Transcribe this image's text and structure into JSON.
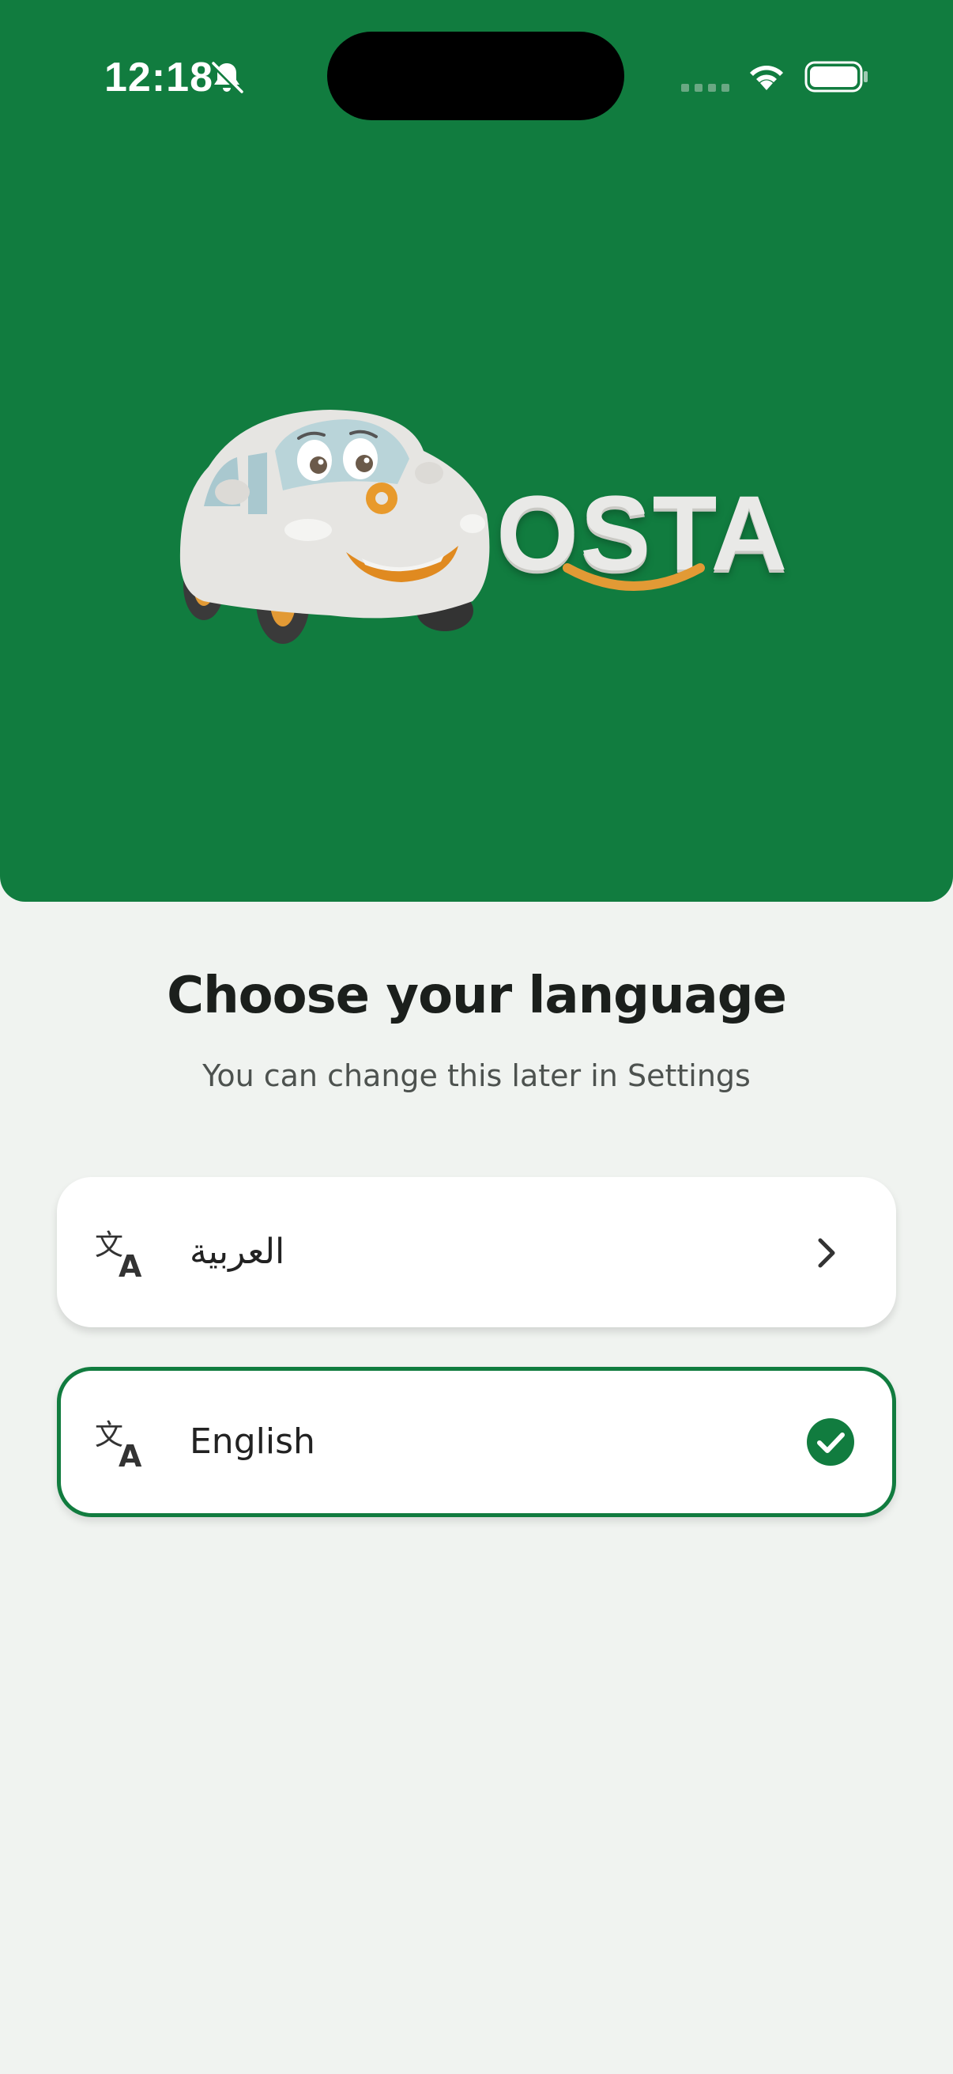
{
  "status_bar": {
    "time": "12:18",
    "icons": [
      "bell-slash-icon",
      "signal-icon",
      "wifi-icon",
      "battery-icon"
    ]
  },
  "header": {
    "background_color": "#117c3f",
    "logo_text": "OSTA",
    "logo_mascot": "car-mascot"
  },
  "main": {
    "title": "Choose your language",
    "subtitle": "You can change this later in Settings"
  },
  "languages": [
    {
      "label": "العربية",
      "icon": "translate-icon",
      "trailing_icon": "chevron-right-icon",
      "selected": false
    },
    {
      "label": "English",
      "icon": "translate-icon",
      "trailing_icon": "check-circle-icon",
      "selected": true
    }
  ],
  "colors": {
    "accent": "#117c3f",
    "background": "#f0f3f0",
    "card": "#ffffff",
    "logo_orange": "#e89a2c"
  }
}
